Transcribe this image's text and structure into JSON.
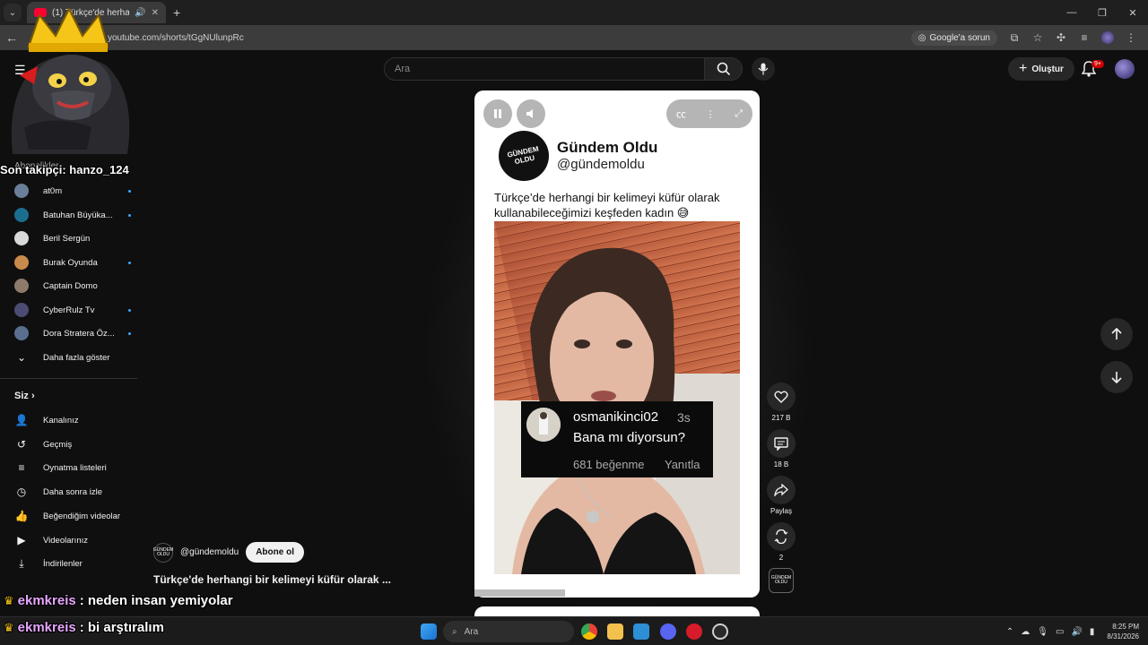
{
  "browser": {
    "tab_title": "(1) Türkçe'de herhangi bir",
    "url": "youtube.com/shorts/tGgNUlunpRc",
    "google_button": "Google'a sorun",
    "new_tab_icon": "plus-icon"
  },
  "header": {
    "search_placeholder": "Ara",
    "create_label": "Oluştur",
    "notification_badge": "9+"
  },
  "overlay": {
    "follower_text": "Son takipçi: hanzo_124",
    "chat": [
      {
        "user": "ekmkreis",
        "message": ": neden insan yemiyolar"
      },
      {
        "user": "ekmkreis",
        "message": ": bi arştıralım"
      }
    ]
  },
  "sidebar": {
    "subscriptions_heading": "Abonelikler",
    "subscriptions": [
      {
        "label": "at0m",
        "color": "#6a7f99",
        "dot": true
      },
      {
        "label": "Batuhan Büyüka...",
        "color": "#1b6e8f",
        "dot": true
      },
      {
        "label": "Beril Sergün",
        "color": "#d9d9d9",
        "dot": false
      },
      {
        "label": "Burak Oyunda",
        "color": "#c98a4b",
        "dot": true
      },
      {
        "label": "Captain Domo",
        "color": "#8d7a6a",
        "dot": false
      },
      {
        "label": "CyberRulz Tv",
        "color": "#4b4b73",
        "dot": true
      },
      {
        "label": "Dora Stratera Öz...",
        "color": "#5a6f8f",
        "dot": true
      }
    ],
    "show_more": "Daha fazla göster",
    "you_heading": "Siz",
    "you_items": [
      {
        "label": "Kanalınız",
        "icon": "channel-icon"
      },
      {
        "label": "Geçmiş",
        "icon": "history-icon"
      },
      {
        "label": "Oynatma listeleri",
        "icon": "playlist-icon"
      },
      {
        "label": "Daha sonra izle",
        "icon": "clock-icon"
      },
      {
        "label": "Beğendiğim videolar",
        "icon": "thumbs-up-icon"
      },
      {
        "label": "Videolarınız",
        "icon": "video-icon"
      },
      {
        "label": "İndirilenler",
        "icon": "download-icon"
      }
    ]
  },
  "short": {
    "post_name": "Gündem Oldu",
    "post_handle": "@gündemoldu",
    "logo_text": "GÜNDEM OLDU",
    "caption": "Türkçe’de herhangi bir kelimeyi küfür olarak kullanabileceğimizi keşfeden kadın 😅",
    "comment": {
      "user": "osmanikinci02",
      "time": "3s",
      "text": "Bana mı diyorsun?",
      "likes": "681 beğenme",
      "reply": "Yanıtla"
    },
    "channel_handle": "@gündemoldu",
    "subscribe_label": "Abone ol",
    "title": "Türkçe'de herhangi bir kelimeyi küfür olarak ..."
  },
  "actions": {
    "likes": "217 B",
    "comments": "18 B",
    "share": "Paylaş",
    "remix": "2"
  },
  "taskbar": {
    "search_placeholder": "Ara",
    "time": "8:25 PM",
    "date": "8/31/2026"
  },
  "colors": {
    "accent_red": "#ff0033",
    "link_blue": "#3ea6ff",
    "chat_user": "#e6a6ff"
  }
}
